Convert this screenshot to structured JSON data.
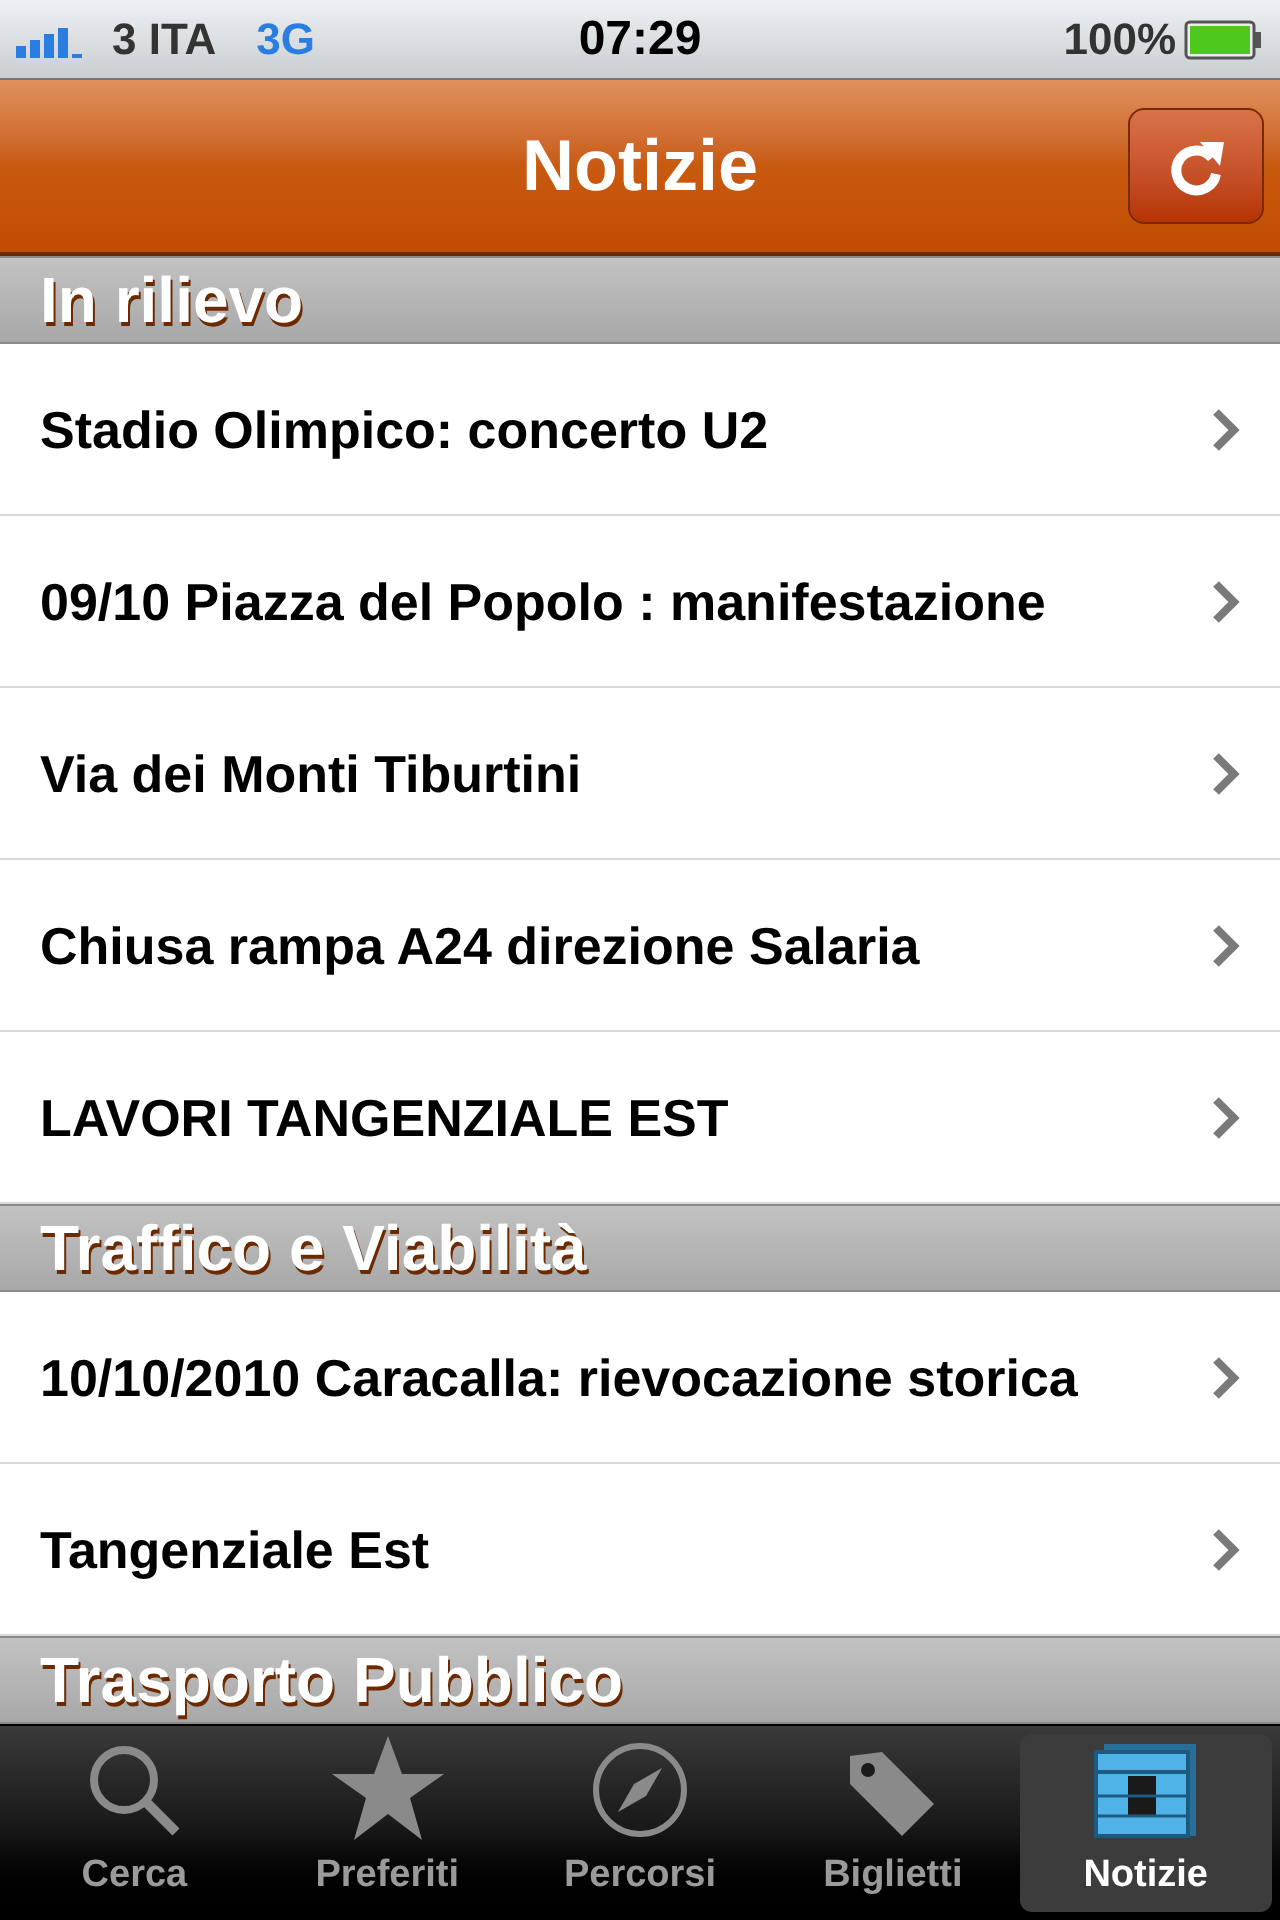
{
  "status_bar": {
    "carrier": "3 ITA",
    "network": "3G",
    "time": "07:29",
    "battery": "100%"
  },
  "nav_bar": {
    "title": "Notizie"
  },
  "sections": [
    {
      "title": "In rilievo",
      "items": [
        "Stadio Olimpico: concerto U2",
        "09/10 Piazza del Popolo : manifestazione",
        "Via dei Monti Tiburtini",
        "Chiusa rampa A24 direzione Salaria",
        "LAVORI TANGENZIALE EST"
      ]
    },
    {
      "title": "Traffico e Viabilità",
      "items": [
        "10/10/2010 Caracalla: rievocazione storica",
        "Tangenziale Est"
      ]
    },
    {
      "title": "Trasporto Pubblico"
    }
  ],
  "tab_bar": [
    {
      "label": "Cerca",
      "kind": "search",
      "selected": false
    },
    {
      "label": "Preferiti",
      "kind": "star",
      "selected": false
    },
    {
      "label": "Percorsi",
      "kind": "compass",
      "selected": false
    },
    {
      "label": "Biglietti",
      "kind": "tag",
      "selected": false
    },
    {
      "label": "Notizie",
      "kind": "news",
      "selected": true
    }
  ]
}
